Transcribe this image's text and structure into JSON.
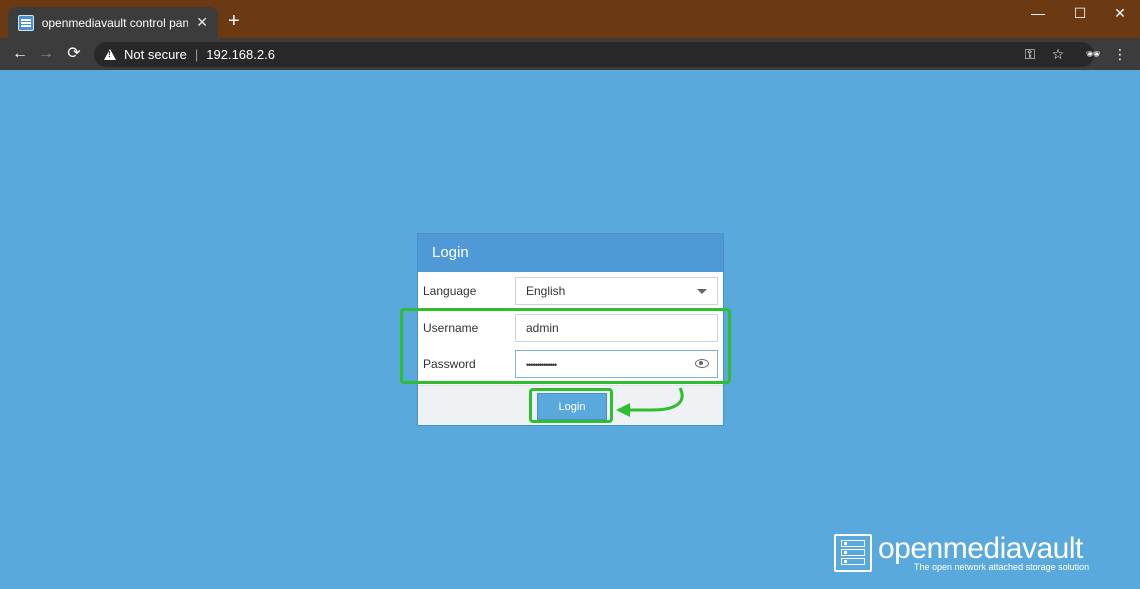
{
  "browser": {
    "tab_title": "openmediavault control panel - ",
    "tab_close": "✕",
    "new_tab": "+",
    "security_label": "Not secure",
    "separator": "|",
    "url": "192.168.2.6",
    "controls": {
      "minimize": "—",
      "maximize": "☐",
      "close": "✕"
    },
    "nav": {
      "back": "←",
      "forward": "→",
      "reload": "⟳"
    },
    "right_icons": {
      "key": "⚿",
      "star": "☆",
      "incognito": "🕶",
      "menu": "⋮"
    }
  },
  "login": {
    "title": "Login",
    "language_label": "Language",
    "language_value": "English",
    "username_label": "Username",
    "username_value": "admin",
    "password_label": "Password",
    "password_value": "••••••••••••••",
    "button_label": "Login"
  },
  "branding": {
    "name": "openmediavault",
    "tagline": "The open network attached storage solution"
  },
  "colors": {
    "background": "#5aa9dc",
    "highlight": "#2fbe2f",
    "header": "#4f9ad6"
  }
}
